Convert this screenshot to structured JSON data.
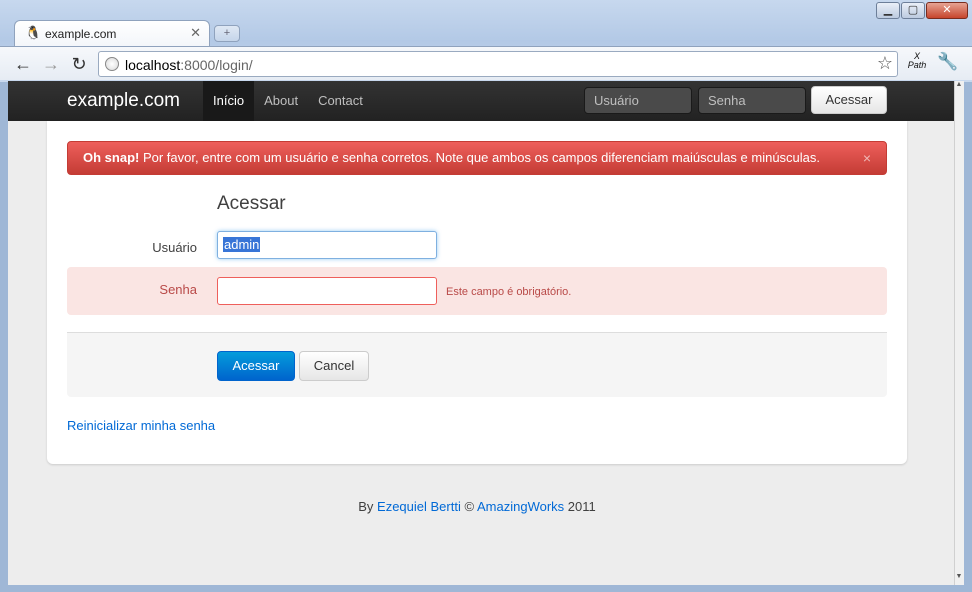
{
  "browser": {
    "tab_title": "example.com",
    "url_host": "localhost",
    "url_rest": ":8000/login/",
    "xpath_label_1": "X",
    "xpath_label_2": "Path"
  },
  "topbar": {
    "brand": "example.com",
    "nav": [
      {
        "label": "Início",
        "active": true
      },
      {
        "label": "About"
      },
      {
        "label": "Contact"
      }
    ],
    "username_placeholder": "Usuário",
    "password_placeholder": "Senha",
    "login_button": "Acessar"
  },
  "alert": {
    "strong": "Oh snap!",
    "message": "Por favor, entre com um usuário e senha corretos. Note que ambos os campos diferenciam maiúsculas e minúsculas.",
    "close": "×"
  },
  "form": {
    "legend": "Acessar",
    "username_label": "Usuário",
    "username_value": "admin",
    "password_label": "Senha",
    "password_error": "Este campo é obrigatório.",
    "submit": "Acessar",
    "cancel": "Cancel"
  },
  "reset_link": "Reinicializar minha senha",
  "footer": {
    "by": "By",
    "author": "Ezequiel Bertti",
    "copy": "©",
    "company": "AmazingWorks",
    "year": "2011"
  },
  "colors": {
    "alert": "#c43c35",
    "primary": "#0064cd",
    "link": "#0069d6",
    "topbar": "#222222"
  }
}
